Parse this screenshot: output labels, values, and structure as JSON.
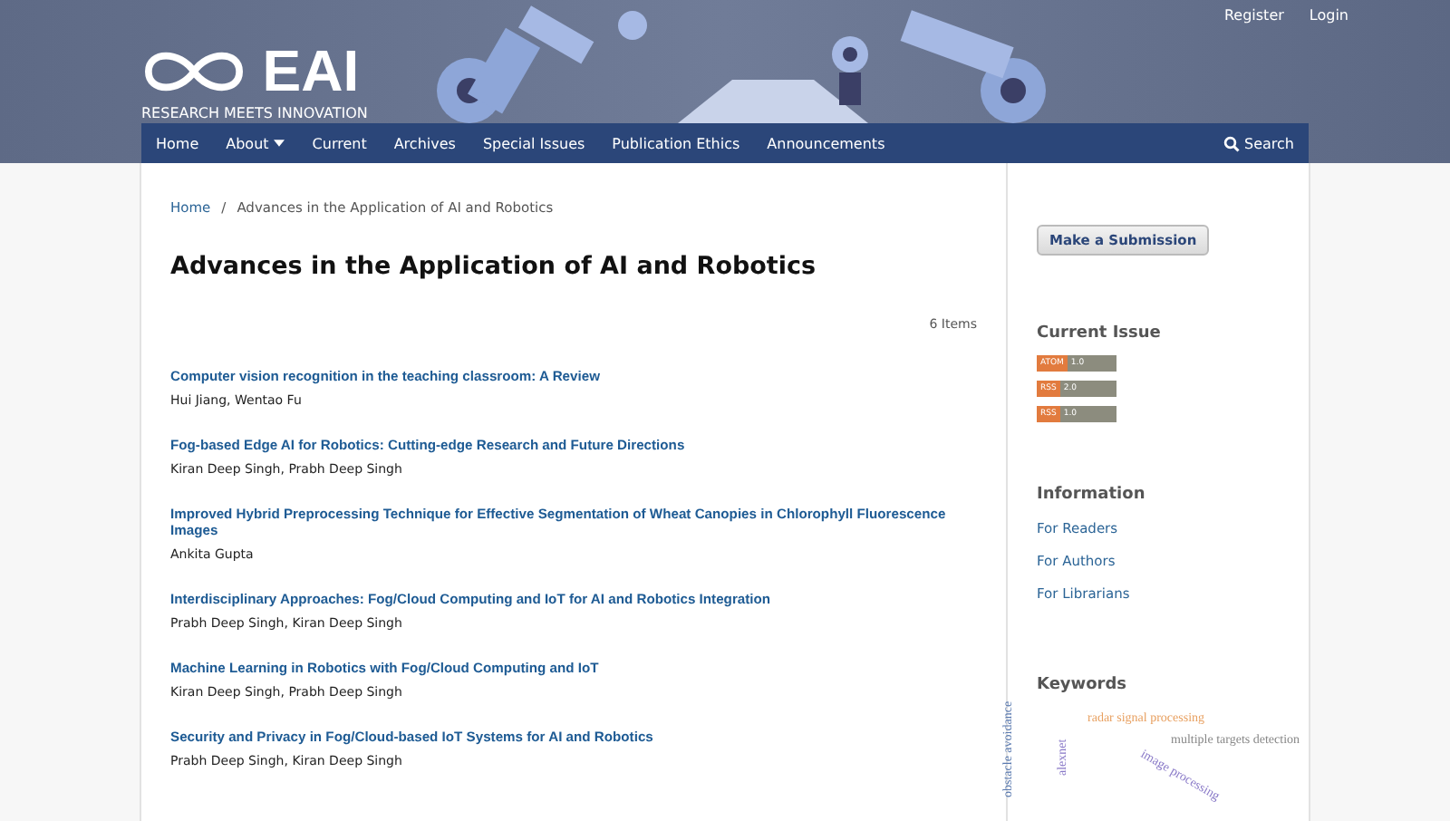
{
  "header": {
    "logo": "EAI",
    "tagline": "RESEARCH MEETS INNOVATION",
    "user_links": [
      "Register",
      "Login"
    ]
  },
  "nav": {
    "items": [
      {
        "label": "Home",
        "has_menu": false
      },
      {
        "label": "About",
        "has_menu": true
      },
      {
        "label": "Current",
        "has_menu": false
      },
      {
        "label": "Archives",
        "has_menu": false
      },
      {
        "label": "Special Issues",
        "has_menu": false
      },
      {
        "label": "Publication Ethics",
        "has_menu": false
      },
      {
        "label": "Announcements",
        "has_menu": false
      }
    ],
    "search": "Search"
  },
  "breadcrumb": {
    "home": "Home",
    "separator": "/",
    "current": "Advances in the Application of AI and Robotics"
  },
  "title": "Advances in the Application of AI and Robotics",
  "count": "6 Items",
  "articles": [
    {
      "title": "Computer vision recognition in the teaching classroom: A Review",
      "authors": "Hui Jiang, Wentao Fu"
    },
    {
      "title": "Fog-based Edge AI for Robotics: Cutting-edge Research and Future Directions",
      "authors": "Kiran Deep Singh, Prabh Deep Singh"
    },
    {
      "title": "Improved Hybrid Preprocessing Technique for Effective Segmentation of Wheat Canopies in Chlorophyll Fluorescence Images",
      "authors": "Ankita Gupta"
    },
    {
      "title": "Interdisciplinary Approaches: Fog/Cloud Computing and IoT for AI and Robotics Integration",
      "authors": "Prabh Deep Singh, Kiran Deep Singh"
    },
    {
      "title": "Machine Learning in Robotics with Fog/Cloud Computing and IoT",
      "authors": "Kiran Deep Singh, Prabh Deep Singh"
    },
    {
      "title": "Security and Privacy in Fog/Cloud-based IoT Systems for AI and Robotics",
      "authors": "Prabh Deep Singh, Kiran Deep Singh"
    }
  ],
  "sidebar": {
    "submit": "Make a Submission",
    "current_issue": {
      "heading": "Current Issue",
      "feeds": [
        {
          "name": "ATOM",
          "version": "1.0"
        },
        {
          "name": "RSS",
          "version": "2.0"
        },
        {
          "name": "RSS",
          "version": "1.0"
        }
      ]
    },
    "information": {
      "heading": "Information",
      "links": [
        "For Readers",
        "For Authors",
        "For Librarians"
      ]
    },
    "keywords": {
      "heading": "Keywords",
      "items": [
        {
          "text": "radar signal processing",
          "color": "#e8a060"
        },
        {
          "text": "multiple targets detection",
          "color": "#888888"
        },
        {
          "text": "image processing",
          "color": "#8a7ac8"
        },
        {
          "text": "obstacle avoidance",
          "color": "#5a7ab0"
        },
        {
          "text": "alexnet",
          "color": "#8a7ac8"
        }
      ]
    }
  }
}
